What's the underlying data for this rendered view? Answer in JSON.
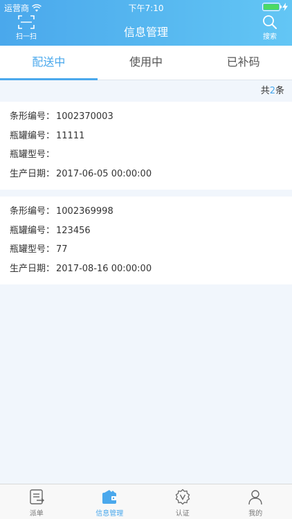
{
  "status_bar": {
    "carrier": "运营商",
    "time": "下午7:10"
  },
  "nav": {
    "title": "信息管理",
    "scan_label": "扫一扫",
    "search_label": "搜索"
  },
  "tabs": [
    {
      "label": "配送中",
      "active": true
    },
    {
      "label": "使用中",
      "active": false
    },
    {
      "label": "已补码",
      "active": false
    }
  ],
  "summary": {
    "prefix": "共",
    "count": "2",
    "suffix": "条"
  },
  "records": [
    {
      "fields": [
        {
          "label": "条形编号：",
          "value": "1002370003"
        },
        {
          "label": "瓶罐编号：",
          "value": "11111"
        },
        {
          "label": "瓶罐型号：",
          "value": ""
        },
        {
          "label": "生产日期：",
          "value": "2017-06-05 00:00:00"
        }
      ]
    },
    {
      "fields": [
        {
          "label": "条形编号：",
          "value": "1002369998"
        },
        {
          "label": "瓶罐编号：",
          "value": "123456"
        },
        {
          "label": "瓶罐型号：",
          "value": "77"
        },
        {
          "label": "生产日期：",
          "value": "2017-08-16 00:00:00"
        }
      ]
    }
  ],
  "tabbar": [
    {
      "label": "派单",
      "icon": "dispatch-icon",
      "active": false
    },
    {
      "label": "信息管理",
      "icon": "wallet-icon",
      "active": true
    },
    {
      "label": "认证",
      "icon": "badge-icon",
      "active": false
    },
    {
      "label": "我的",
      "icon": "user-icon",
      "active": false
    }
  ],
  "colors": {
    "accent": "#4aa8ec",
    "header_gradient_start": "#4aa8ec",
    "header_gradient_end": "#63c6f5",
    "page_background": "#f1f6fc",
    "battery": "#4cd964"
  }
}
